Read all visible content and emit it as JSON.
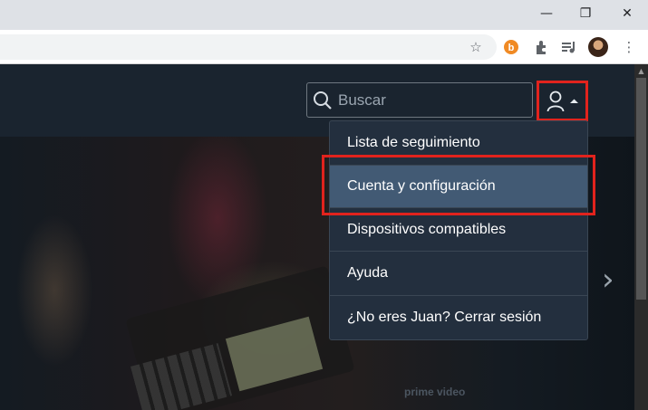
{
  "browser": {
    "window_controls": {
      "minimize": "—",
      "restore": "❐",
      "close": "✕"
    },
    "toolbar_icons": [
      "star-icon",
      "bittorrent-icon",
      "extensions-icon",
      "media-control-icon",
      "profile-avatar",
      "menu-icon"
    ]
  },
  "site": {
    "search": {
      "placeholder": "Buscar",
      "value": ""
    },
    "watermark": "prime video",
    "account_menu": {
      "items": [
        {
          "label": "Lista de seguimiento"
        },
        {
          "label": "Cuenta y configuración",
          "highlighted": true
        },
        {
          "label": "Dispositivos compatibles"
        },
        {
          "label": "Ayuda"
        },
        {
          "label": "¿No eres Juan? Cerrar sesión"
        }
      ]
    }
  },
  "colors": {
    "annotation_red": "#e1231d",
    "menu_bg": "#232f3e",
    "menu_active_bg": "#425a74",
    "nav_bg": "#1a242f"
  }
}
